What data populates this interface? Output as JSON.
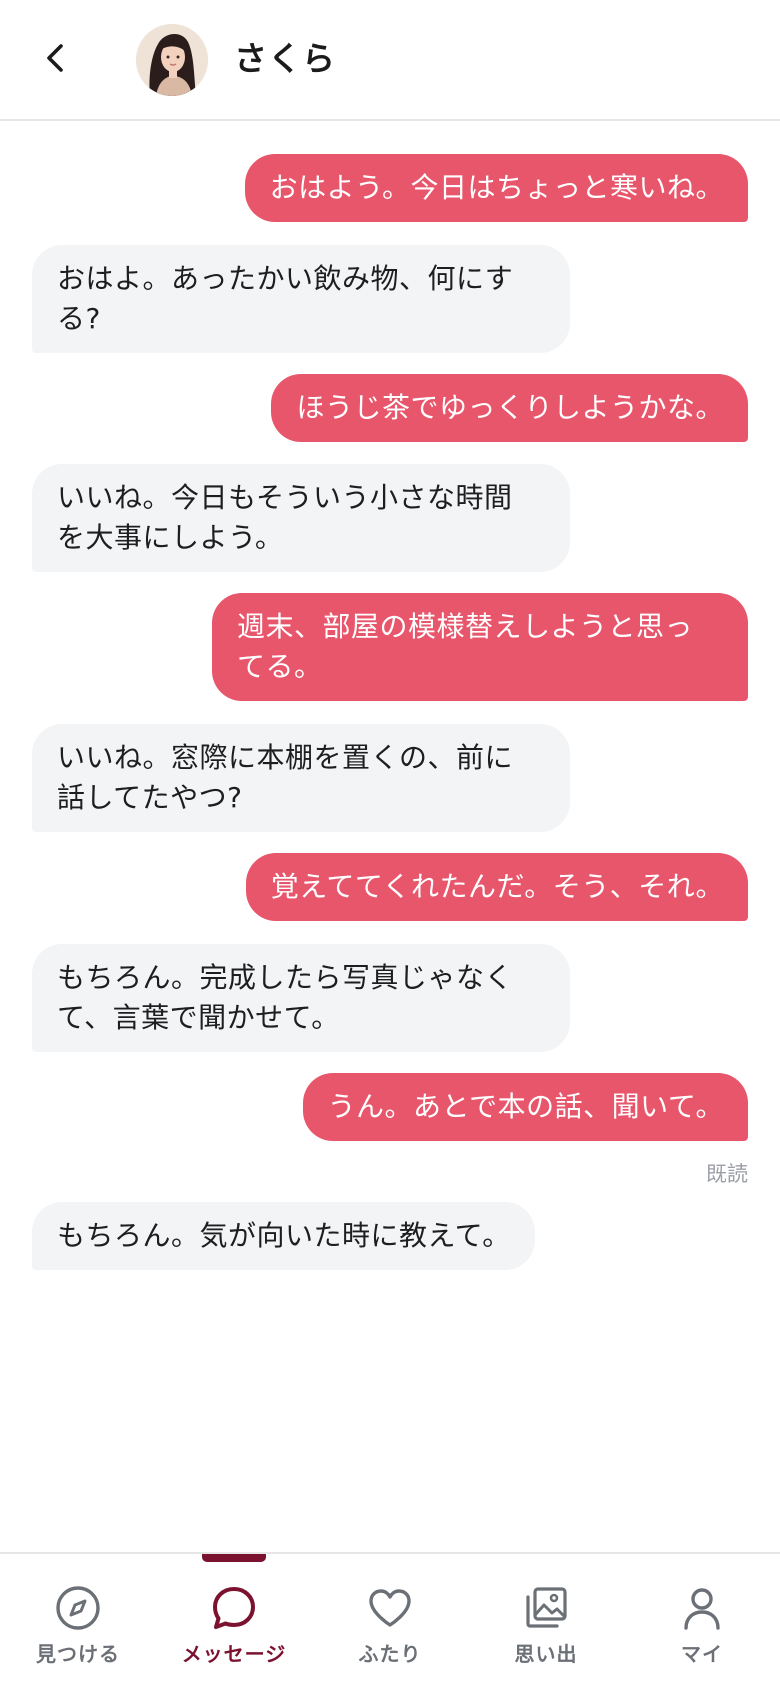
{
  "header": {
    "contact_name": "さくら"
  },
  "messages": [
    {
      "side": "out",
      "text": "おはよう。今日はちょっと寒いね。"
    },
    {
      "side": "in",
      "text": "おはよ。あったかい飲み物、何にす\nる?"
    },
    {
      "side": "out",
      "text": "ほうじ茶でゆっくりしようかな。"
    },
    {
      "side": "in",
      "text": "いいね。今日もそういう小さな時間\nを大事にしよう。"
    },
    {
      "side": "out",
      "text": "週末、部屋の模様替えしようと思っ\nてる。"
    },
    {
      "side": "in",
      "text": "いいね。窓際に本棚を置くの、前に\n話してたやつ?"
    },
    {
      "side": "out",
      "text": "覚えててくれたんだ。そう、それ。"
    },
    {
      "side": "in",
      "text": "もちろん。完成したら写真じゃなく\nて、言葉で聞かせて。"
    },
    {
      "side": "out",
      "text": "うん。あとで本の話、聞いて。"
    },
    {
      "side": "in",
      "text": "もちろん。気が向いた時に教えて。"
    }
  ],
  "read_receipt": "既読",
  "nav": {
    "items": [
      {
        "label": "見つける",
        "icon": "compass-icon",
        "active": false
      },
      {
        "label": "メッセージ",
        "icon": "chat-bubble-icon",
        "active": true
      },
      {
        "label": "ふたり",
        "icon": "heart-icon",
        "active": false
      },
      {
        "label": "思い出",
        "icon": "photo-album-icon",
        "active": false
      },
      {
        "label": "マイ",
        "icon": "person-icon",
        "active": false
      }
    ]
  },
  "colors": {
    "outgoing_bubble": "#e8566c",
    "incoming_bubble": "#f3f4f6",
    "accent": "#7b1230",
    "nav_inactive": "#6b6f76"
  }
}
